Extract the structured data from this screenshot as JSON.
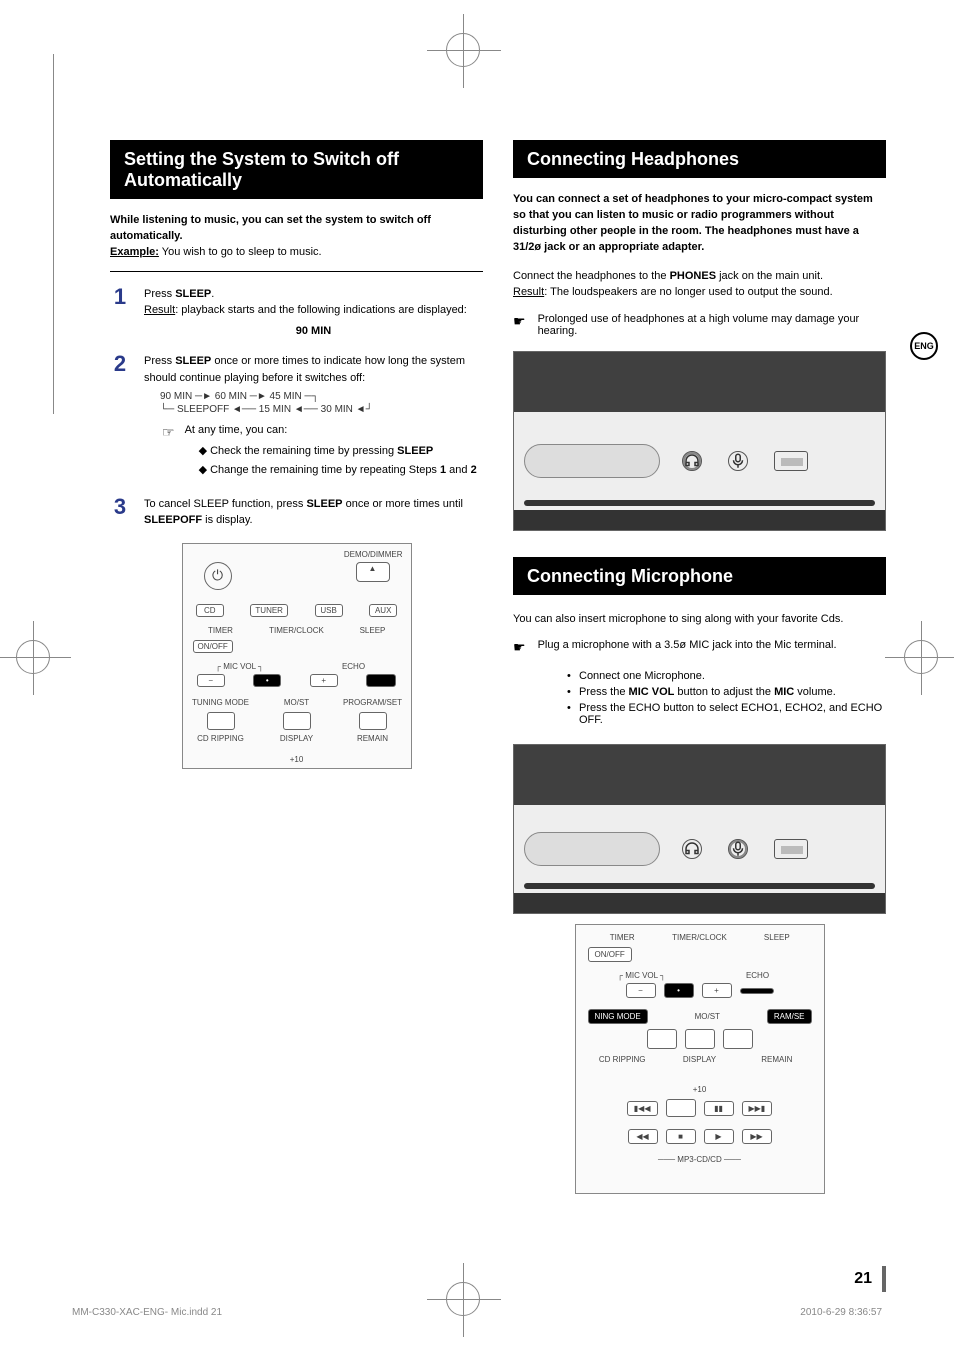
{
  "left": {
    "heading": "Setting the System to Switch off Automatically",
    "intro_line1": "While listening to music, you can set the system to switch off automatically.",
    "intro_example_label": "Example:",
    "intro_example_text": " You wish to go to sleep to music.",
    "steps": {
      "s1": {
        "num": "1",
        "line": "Press ",
        "b": "SLEEP",
        "dot": ".",
        "result_label": "Result",
        "result_text": ": playback starts and the following indications are displayed:",
        "ninety": "90 MIN"
      },
      "s2": {
        "num": "2",
        "line1": "Press ",
        "b1": "SLEEP",
        "line1b": " once or more times to indicate how long the system should continue playing before it switches off:",
        "cycle_top": "90 MIN ─► 60 MIN ─► 45 MIN ─┐",
        "cycle_bot": "└─ SLEEPOFF ◄── 15 MIN ◄── 30 MIN ◄┘",
        "hint_lead": "At any time, you can:",
        "hint_a_pre": "Check the remaining time by pressing ",
        "hint_a_b": "SLEEP",
        "hint_b_pre": "Change the remaining time by repeating Steps ",
        "hint_b_b1": "1",
        "hint_b_mid": " and ",
        "hint_b_b2": "2"
      },
      "s3": {
        "num": "3",
        "line_pre": "To cancel SLEEP function, press ",
        "b1": "SLEEP",
        "line_mid": " once or more times until  ",
        "b2": "SLEEPOFF",
        "line_post": " is display."
      }
    },
    "panel": {
      "demo": "DEMO/DIMMER",
      "cd": "CD",
      "tuner": "TUNER",
      "usb": "USB",
      "aux": "AUX",
      "timer": "TIMER",
      "timerclock": "TIMER/CLOCK",
      "sleep": "SLEEP",
      "onoff": "ON/OFF",
      "micvol": "┌ MIC VOL ┐",
      "echo": "ECHO",
      "tuning": "TUNING MODE",
      "most": "MO/ST",
      "program": "PROGRAM/SET",
      "cdrip": "CD RIPPING",
      "display": "DISPLAY",
      "remain": "REMAIN",
      "plus10": "+10"
    }
  },
  "right": {
    "eng": "ENG",
    "headphones_heading": "Connecting Headphones",
    "headphones_intro": "You can connect a set of headphones to your micro-compact system so that you can listen to music or radio programmers without disturbing other people in the room. The headphones must have a 31/2ø jack or an appropriate adapter.",
    "headphones_para_pre": "Connect the headphones to the ",
    "headphones_para_b": "PHONES",
    "headphones_para_post": " jack on the main unit.",
    "headphones_result_label": "Result",
    "headphones_result_text": ": The loudspeakers are no longer used to output the sound.",
    "headphones_note": "Prolonged use of headphones at a high volume may damage your hearing.",
    "microphone_heading": "Connecting Microphone",
    "microphone_para": "You can also insert microphone to sing along with your favorite Cds.",
    "microphone_note": "Plug a microphone with a 3.5ø MIC jack into the Mic terminal.",
    "mic_steps": {
      "a": "Connect one Microphone.",
      "b_pre": "Press the  ",
      "b_b1": "MIC VOL",
      "b_mid": " button to adjust the ",
      "b_b2": "MIC",
      "b_post": " volume.",
      "c": "Press the ECHO button to select ECHO1, ECHO2, and ECHO OFF."
    },
    "panel": {
      "timer": "TIMER",
      "timerclock": "TIMER/CLOCK",
      "sleep": "SLEEP",
      "onoff": "ON/OFF",
      "micvol": "┌ MIC VOL ┐",
      "echo": "ECHO",
      "ning": "NING MODE",
      "most": "MO/ST",
      "ramse": "RAM/SE",
      "cdrip": "CD RIPPING",
      "display": "DISPLAY",
      "remain": "REMAIN",
      "plus10": "+10",
      "mp3": "─── MP3-CD/CD ───"
    }
  },
  "page_number": "21",
  "footer_left": "MM-C330-XAC-ENG- Mic.indd   21",
  "footer_right": "2010-6-29   8:36:57"
}
